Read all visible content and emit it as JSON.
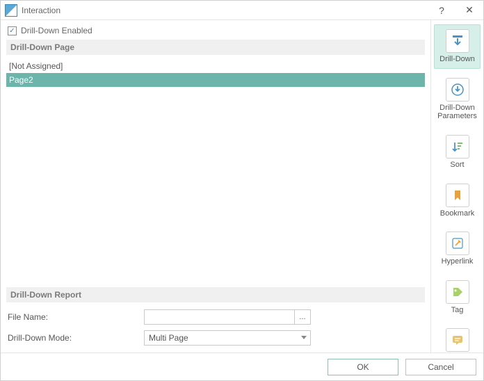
{
  "window": {
    "title": "Interaction",
    "help_label": "?",
    "close_label": "✕"
  },
  "checkbox": {
    "label": "Drill-Down Enabled",
    "checked_glyph": "✓"
  },
  "sections": {
    "page_header": "Drill-Down Page",
    "report_header": "Drill-Down Report"
  },
  "page_list": {
    "items": [
      "[Not Assigned]",
      "Page2"
    ],
    "selected_index": 1
  },
  "report": {
    "filename_label": "File Name:",
    "filename_value": "",
    "browse_label": "...",
    "mode_label": "Drill-Down Mode:",
    "mode_value": "Multi Page"
  },
  "sidebar": {
    "items": [
      {
        "label": "Drill-Down",
        "icon": "drill-down-icon",
        "active": true
      },
      {
        "label": "Drill-Down Parameters",
        "icon": "drill-down-params-icon",
        "active": false
      },
      {
        "label": "Sort",
        "icon": "sort-icon",
        "active": false
      },
      {
        "label": "Bookmark",
        "icon": "bookmark-icon",
        "active": false
      },
      {
        "label": "Hyperlink",
        "icon": "hyperlink-icon",
        "active": false
      },
      {
        "label": "Tag",
        "icon": "tag-icon",
        "active": false
      },
      {
        "label": "Tool Tip",
        "icon": "tooltip-icon",
        "active": false
      }
    ]
  },
  "footer": {
    "ok_label": "OK",
    "cancel_label": "Cancel"
  }
}
